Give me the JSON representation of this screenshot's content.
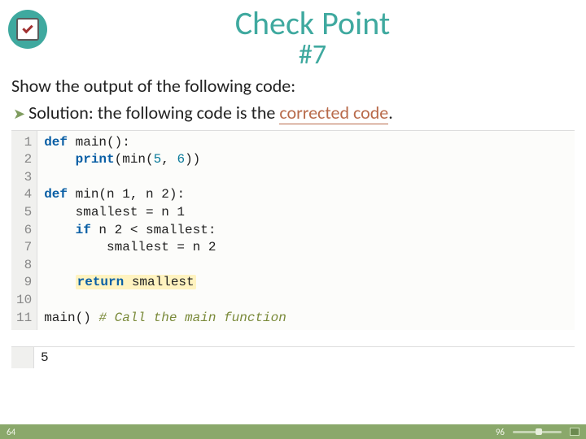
{
  "header": {
    "title_line1": "Check Point",
    "title_line2": "#7"
  },
  "prompt": "Show the output of the following code:",
  "solution": {
    "prefix": "Solution: the following code is the ",
    "highlight": "corrected code",
    "suffix": "."
  },
  "code": {
    "gutter": "1\n2\n3\n4\n5\n6\n7\n8\n9\n10\n11",
    "kw_def_1": "def",
    "rest_1": " main():",
    "indent_2": "    ",
    "kw_print": "print",
    "open_2": "(min(",
    "num_2a": "5",
    "sep_2": ", ",
    "num_2b": "6",
    "close_2": "))",
    "kw_def_4": "def",
    "rest_4": " min(n 1, n 2):",
    "line_5": "    smallest = n 1",
    "indent_6": "    ",
    "kw_if": "if",
    "rest_6": " n 2 < smallest:",
    "line_7": "        smallest = n 2",
    "indent_9": "    ",
    "kw_return": "return",
    "ret_9": " smallest",
    "call_11": "main() ",
    "cmt_11": "# Call the main function"
  },
  "output": "5",
  "footer": {
    "left": "64",
    "zoom": "96"
  }
}
